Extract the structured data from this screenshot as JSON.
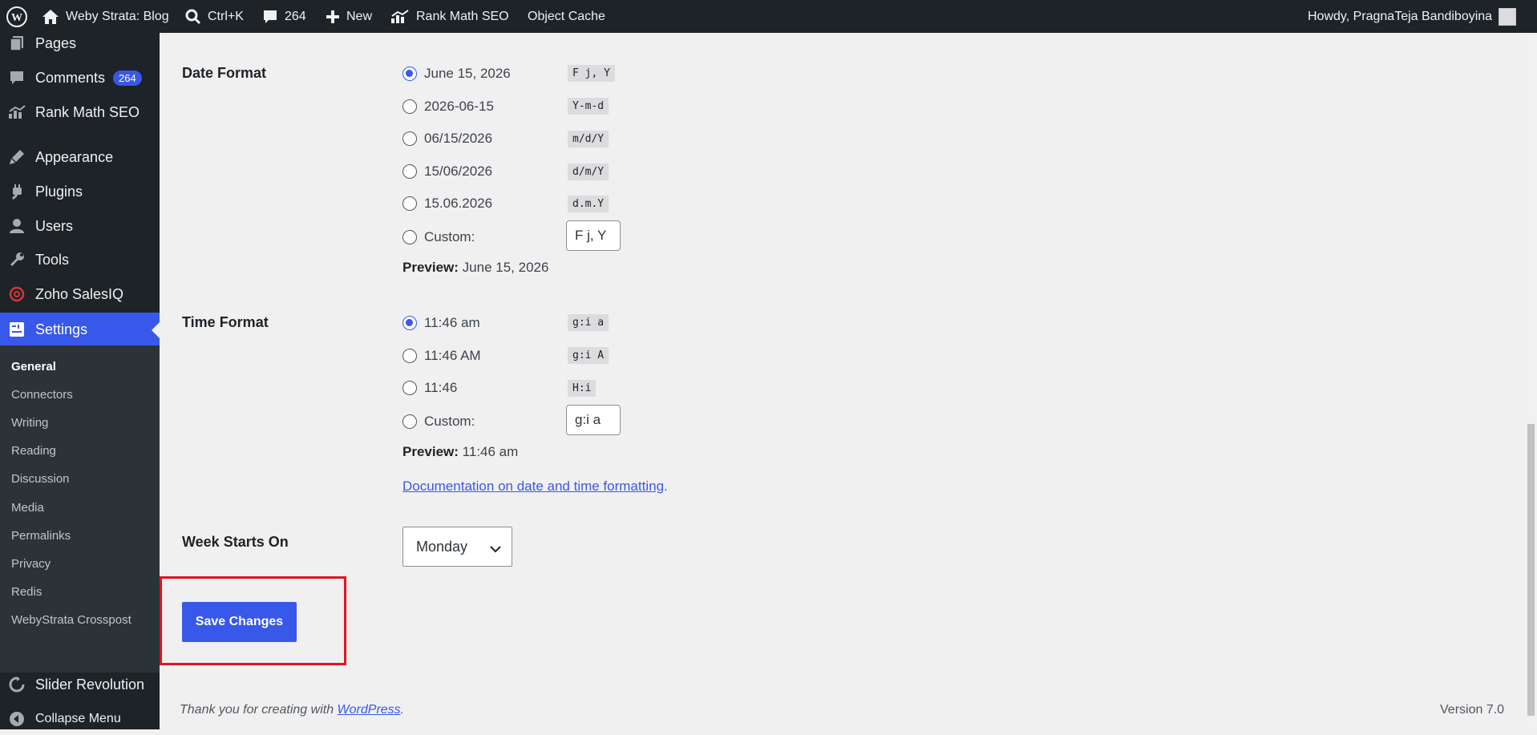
{
  "admin_bar": {
    "site_name": "Weby Strata: Blog",
    "search_shortcut": "Ctrl+K",
    "comments_count": "264",
    "new_label": "New",
    "rank_math_label": "Rank Math SEO",
    "object_cache_label": "Object Cache",
    "howdy": "Howdy, PragnaTeja Bandiboyina"
  },
  "sidebar": {
    "items": [
      {
        "label": "Pages",
        "icon": "pages-icon"
      },
      {
        "label": "Comments",
        "icon": "comments-icon",
        "badge": "264"
      },
      {
        "label": "Rank Math SEO",
        "icon": "rank-math-icon"
      },
      {
        "label": "Appearance",
        "icon": "appearance-icon"
      },
      {
        "label": "Plugins",
        "icon": "plugins-icon"
      },
      {
        "label": "Users",
        "icon": "users-icon"
      },
      {
        "label": "Tools",
        "icon": "tools-icon"
      },
      {
        "label": "Zoho SalesIQ",
        "icon": "zoho-icon"
      },
      {
        "label": "Settings",
        "icon": "settings-icon"
      }
    ],
    "submenu": [
      "General",
      "Connectors",
      "Writing",
      "Reading",
      "Discussion",
      "Media",
      "Permalinks",
      "Privacy",
      "Redis",
      "WebyStrata Crosspost"
    ],
    "slider_revolution": "Slider Revolution",
    "collapse": "Collapse Menu"
  },
  "date_format": {
    "label": "Date Format",
    "options": [
      {
        "text": "June 15, 2026",
        "code": "F j, Y",
        "checked": true
      },
      {
        "text": "2026-06-15",
        "code": "Y-m-d"
      },
      {
        "text": "06/15/2026",
        "code": "m/d/Y"
      },
      {
        "text": "15/06/2026",
        "code": "d/m/Y"
      },
      {
        "text": "15.06.2026",
        "code": "d.m.Y"
      }
    ],
    "custom_label": "Custom:",
    "custom_value": "F j, Y",
    "preview_label": "Preview:",
    "preview_value": "June 15, 2026"
  },
  "time_format": {
    "label": "Time Format",
    "options": [
      {
        "text": "11:46 am",
        "code": "g:i a",
        "checked": true
      },
      {
        "text": "11:46 AM",
        "code": "g:i A"
      },
      {
        "text": "11:46",
        "code": "H:i"
      }
    ],
    "custom_label": "Custom:",
    "custom_value": "g:i a",
    "preview_label": "Preview:",
    "preview_value": "11:46 am"
  },
  "doc_link": "Documentation on date and time formatting",
  "doc_link_suffix": ".",
  "week_starts": {
    "label": "Week Starts On",
    "value": "Monday"
  },
  "save_button": "Save Changes",
  "footer": {
    "thanks": "Thank you for creating with ",
    "link": "WordPress",
    "suffix": ".",
    "version": "Version 7.0"
  },
  "colors": {
    "accent": "#3858e9",
    "highlight": "#e0141e",
    "sidebar_bg": "#1d2327"
  }
}
